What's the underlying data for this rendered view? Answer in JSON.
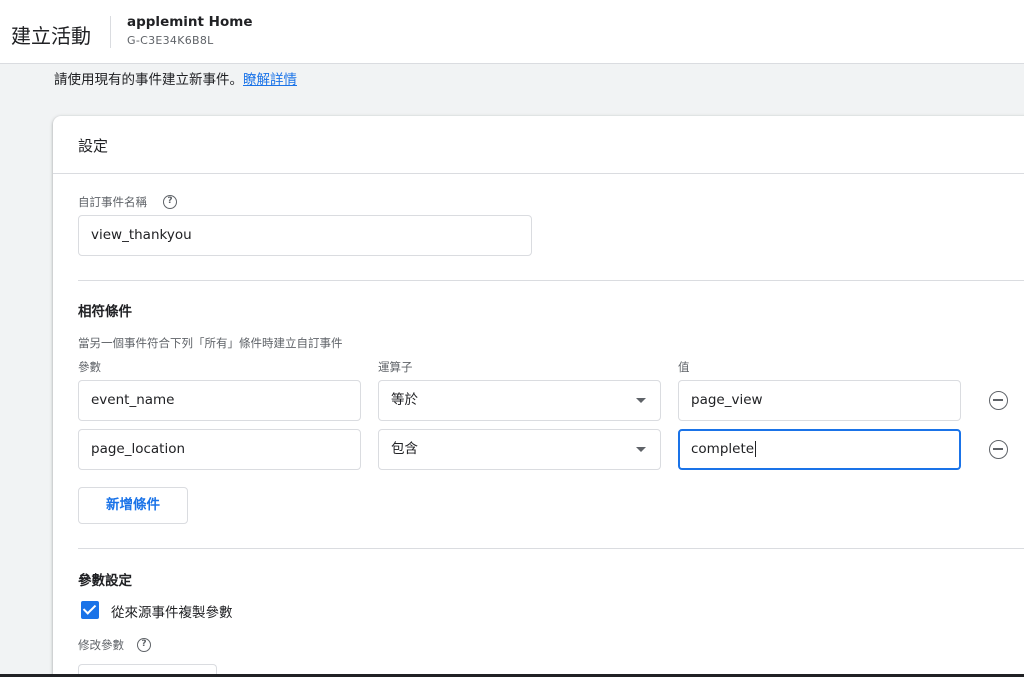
{
  "header": {
    "title": "建立活動",
    "property_name": "applemint Home",
    "property_id": "G-C3E34K6B8L"
  },
  "intro": {
    "text": "請使用現有的事件建立新事件。",
    "link": "瞭解詳情"
  },
  "card": {
    "title": "設定",
    "custom_event": {
      "label": "自訂事件名稱",
      "value": "view_thankyou"
    },
    "matching": {
      "title": "相符條件",
      "description": "當另一個事件符合下列「所有」條件時建立自訂事件",
      "col_param": "參數",
      "col_operator": "運算子",
      "col_value": "值",
      "rows": [
        {
          "param": "event_name",
          "operator": "等於",
          "value": "page_view"
        },
        {
          "param": "page_location",
          "operator": "包含",
          "value": "complete"
        }
      ],
      "add_button": "新增條件"
    },
    "params": {
      "title": "參數設定",
      "copy_checkbox_label": "從來源事件複製參數",
      "copy_checked": true,
      "modify_label": "修改參數"
    }
  },
  "icons": {
    "help": "help-circle-icon",
    "remove": "remove-circle-icon",
    "dropdown": "dropdown-arrow-icon",
    "check": "check-icon"
  },
  "colors": {
    "accent": "#1a73e8",
    "border": "#dadce0",
    "muted_text": "#5f6368"
  }
}
